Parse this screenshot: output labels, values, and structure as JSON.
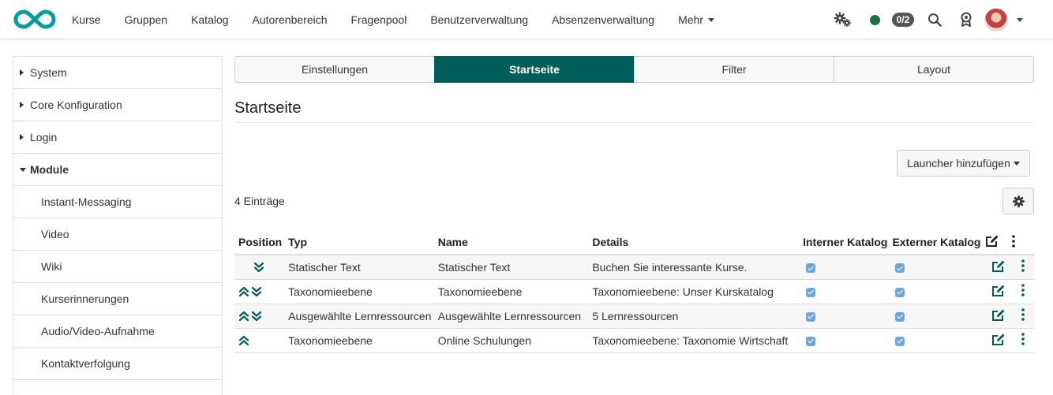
{
  "nav": {
    "items": [
      {
        "label": "Kurse"
      },
      {
        "label": "Gruppen"
      },
      {
        "label": "Katalog"
      },
      {
        "label": "Autorenbereich"
      },
      {
        "label": "Fragenpool"
      },
      {
        "label": "Benutzerverwaltung"
      },
      {
        "label": "Absenzenverwaltung"
      },
      {
        "label": "Mehr"
      }
    ],
    "chat_badge": "0/2",
    "status_color": "#1a6e3c",
    "brand_color": "#009f9a"
  },
  "sidebar": {
    "items": [
      {
        "label": "System"
      },
      {
        "label": "Core Konfiguration"
      },
      {
        "label": "Login"
      },
      {
        "label": "Module"
      },
      {
        "label": "Instant-Messaging"
      },
      {
        "label": "Video"
      },
      {
        "label": "Wiki"
      },
      {
        "label": "Kurserinnerungen"
      },
      {
        "label": "Audio/Video-Aufnahme"
      },
      {
        "label": "Kontaktverfolgung"
      }
    ]
  },
  "tabs": [
    {
      "label": "Einstellungen"
    },
    {
      "label": "Startseite"
    },
    {
      "label": "Filter"
    },
    {
      "label": "Layout"
    }
  ],
  "accent_color": "#005e5a",
  "page": {
    "title": "Startseite",
    "add_launcher_label": "Launcher hinzufügen",
    "entries_count": "4 Einträge"
  },
  "table": {
    "headers": {
      "position": "Position",
      "typ": "Typ",
      "name": "Name",
      "details": "Details",
      "intern": "Interner Katalog",
      "extern": "Externer Katalog"
    },
    "rows": [
      {
        "typ": "Statischer Text",
        "name": "Statischer Text",
        "details": "Buchen Sie interessante Kurse."
      },
      {
        "typ": "Taxonomieebene",
        "name": "Taxonomieebene",
        "details": "Taxonomieebene: Unser Kurskatalog"
      },
      {
        "typ": "Ausgewählte Lernressourcen",
        "name": "Ausgewählte Lernressourcen",
        "details": "5 Lernressourcen"
      },
      {
        "typ": "Taxonomieebene",
        "name": "Online Schulungen",
        "details": "Taxonomieebene: Taxonomie Wirtschaft"
      }
    ]
  }
}
